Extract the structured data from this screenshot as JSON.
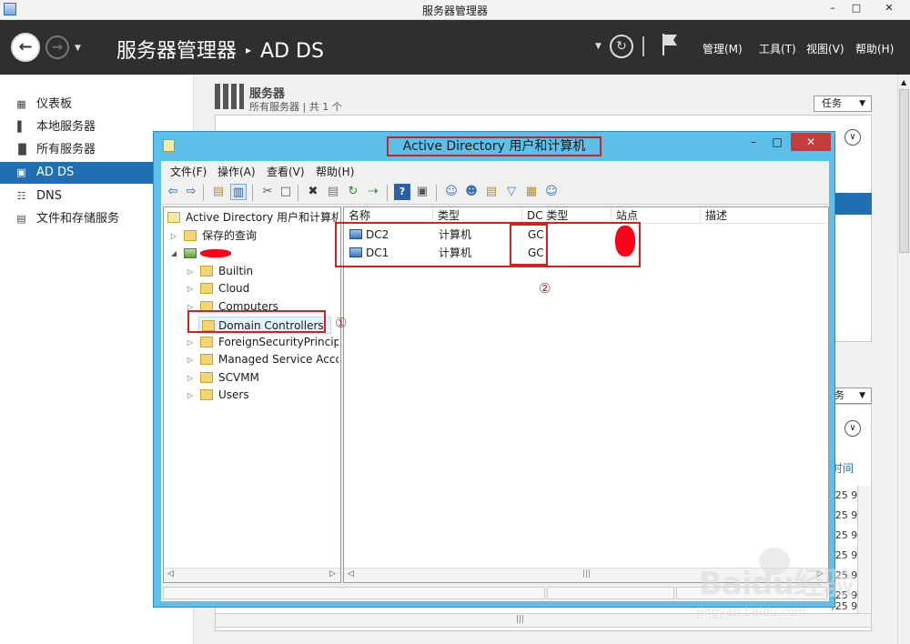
{
  "window": {
    "title": "服务器管理器"
  },
  "header": {
    "breadcrumb": [
      "服务器管理器",
      "AD DS"
    ],
    "menus": [
      "管理(M)",
      "工具(T)",
      "视图(V)",
      "帮助(H)"
    ]
  },
  "sidebar": {
    "items": [
      {
        "label": "仪表板",
        "icon": "dashboard-icon"
      },
      {
        "label": "本地服务器",
        "icon": "server-icon"
      },
      {
        "label": "所有服务器",
        "icon": "servers-icon"
      },
      {
        "label": "AD DS",
        "icon": "adds-icon",
        "active": true
      },
      {
        "label": "DNS",
        "icon": "dns-icon"
      },
      {
        "label": "文件和存储服务",
        "icon": "storage-icon"
      }
    ]
  },
  "main": {
    "servers_tile": {
      "title": "服务器",
      "subtitle": "所有服务器 | 共 1 个",
      "tasks_label": "任务"
    },
    "tasks_label_2": "务",
    "events_col": "时间",
    "dates": [
      "/25 9",
      "/25 9",
      "/25 9",
      "/25 9",
      "/25 9",
      "/25 9",
      "/25 9"
    ]
  },
  "dialog": {
    "title": "Active Directory 用户和计算机",
    "menus": [
      "文件(F)",
      "操作(A)",
      "查看(V)",
      "帮助(H)"
    ],
    "tree": {
      "root": "Active Directory 用户和计算机",
      "saved_queries": "保存的查询",
      "children": [
        "Builtin",
        "Cloud",
        "Computers",
        "Domain Controllers",
        "ForeignSecurityPrincipa",
        "Managed Service Acco",
        "SCVMM",
        "Users"
      ],
      "selected": "Domain Controllers"
    },
    "list": {
      "columns": [
        "名称",
        "类型",
        "DC 类型",
        "站点",
        "描述"
      ],
      "rows": [
        {
          "name": "DC2",
          "type": "计算机",
          "dc_type": "GC"
        },
        {
          "name": "DC1",
          "type": "计算机",
          "dc_type": "GC"
        }
      ]
    }
  },
  "annotations": {
    "callout_1": "①",
    "callout_2": "②",
    "color": "#d32020"
  },
  "watermark": {
    "brand": "Baidu经验",
    "url": "jingyan.baidu.com"
  }
}
